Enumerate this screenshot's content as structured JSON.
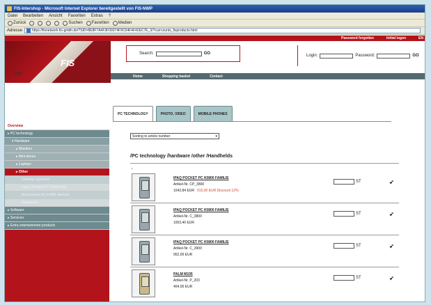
{
  "window": {
    "title": "FIS-Intershop - Microsoft Internet Explorer bereitgestellt von FIS-NWP"
  },
  "menu": [
    "Datei",
    "Bearbeiten",
    "Ansicht",
    "Favoriten",
    "Extras",
    "?"
  ],
  "toolbar": {
    "back": "Zurück",
    "search": "Suchen",
    "favorites": "Favoriten",
    "media": "Medien"
  },
  "address": {
    "label": "Adresse",
    "url": "https://fisnetwork.fis-gmbh.de/?SID=8E8F7A4F3F09374F9C04F4F42EC7E_3/?currcounts_fisproducts.html"
  },
  "header": {
    "top_links": [
      "Password forgotten",
      "Initial logon",
      "EN"
    ],
    "logo": "FIS",
    "logo_sub": "SAP",
    "search_label": "Search:",
    "search_go": "GO",
    "login_label": "Login:",
    "password_label": "Password:",
    "login_go": "GO"
  },
  "nav": [
    "Home",
    "Shopping basket",
    "Contact"
  ],
  "sidebar": [
    {
      "label": "Overview",
      "level": "l0"
    },
    {
      "label": "▸ PC technology",
      "level": "l1"
    },
    {
      "label": "▾ Hardware",
      "level": "l2"
    },
    {
      "label": "▸ Monitors",
      "level": "l3"
    },
    {
      "label": "▸ Mini-drives",
      "level": "l3"
    },
    {
      "label": "▸ Laptops",
      "level": "l3"
    },
    {
      "label": "▸ Other",
      "level": "sel"
    },
    {
      "label": "Desktop organizer",
      "level": "l4"
    },
    {
      "label": "Input / Pocket PC Handhelds",
      "level": "l4b"
    },
    {
      "label": "Accessories for mobile devices",
      "level": "l4"
    },
    {
      "label": "Equipment",
      "level": "l4b"
    },
    {
      "label": "▸ Software",
      "level": "l1"
    },
    {
      "label": "▸ Services",
      "level": "l1"
    },
    {
      "label": "▸ Extra entertainment products",
      "level": "l1"
    }
  ],
  "tabs": [
    "PC TECHNOLOGY",
    "PHOTO, VIDEO",
    "MOBILE PHONES"
  ],
  "sort": {
    "value": "Sorting to article number"
  },
  "content": {
    "title": "/PC technology /hardware /other /Handhelds",
    "marker": "¹"
  },
  "products": [
    {
      "name": "IPAQ POCKET PC H3800 FAMILIE",
      "art": "Artikel-Nr. CP_3800",
      "price": "1042,84 EUR",
      "discount": "915,00 EUR  Discount 12%",
      "unit": "ST"
    },
    {
      "name": "IPAQ POCKET PC H3800 FAMILIE",
      "art": "Artikel-Nr. C_3800",
      "price": "1003,40 EUR",
      "discount": "",
      "unit": "ST"
    },
    {
      "name": "IPAQ POCKET PC H3800 FAMILIE",
      "art": "Artikel-Nr. C_3900",
      "price": "952,00 EUR",
      "discount": "",
      "unit": "ST"
    },
    {
      "name": "PALM M105",
      "art": "Artikel-Nr. P_203",
      "price": "404,00 EUR",
      "discount": "",
      "unit": "ST"
    }
  ]
}
